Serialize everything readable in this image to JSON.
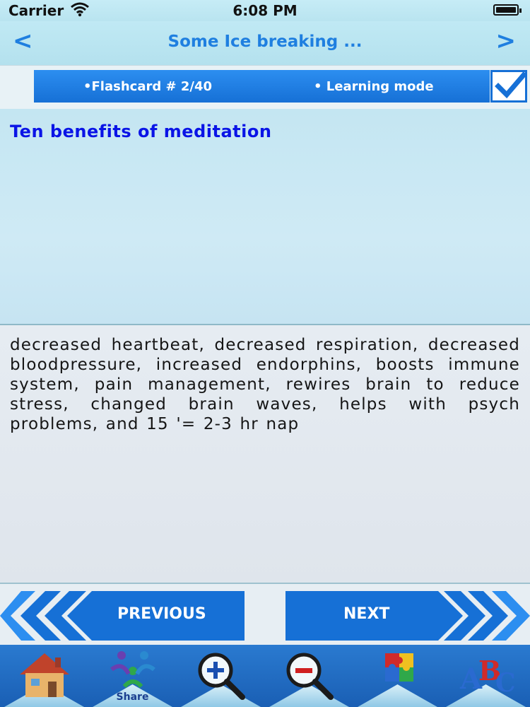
{
  "status_bar": {
    "carrier": "Carrier",
    "time": "6:08 PM"
  },
  "nav": {
    "prev_arrow": "<",
    "title": "Some Ice breaking ...",
    "next_arrow": ">"
  },
  "info": {
    "flashcard": "•Flashcard #  2/40",
    "mode": "• Learning mode",
    "mode_checked": true
  },
  "question": "Ten benefits of meditation",
  "answer": "decreased heartbeat, decreased respiration, decreased bloodpressure, increased endorphins, boosts immune system, pain management, rewires brain to reduce stress, changed brain waves, helps with psych problems, and 15 '= 2-3 hr nap",
  "buttons": {
    "previous": "PREVIOUS",
    "next": "NEXT"
  },
  "toolbar": [
    {
      "icon": "home-icon",
      "caption": ""
    },
    {
      "icon": "share-icon",
      "caption": "Share"
    },
    {
      "icon": "zoom-in-icon",
      "caption": ""
    },
    {
      "icon": "zoom-out-icon",
      "caption": ""
    },
    {
      "icon": "puzzle-icon",
      "caption": ""
    },
    {
      "icon": "abc-icon",
      "caption": ""
    }
  ],
  "colors": {
    "accent": "#1f7fe0",
    "question_text": "#0a14e6",
    "button_blue": "#1670d6"
  }
}
